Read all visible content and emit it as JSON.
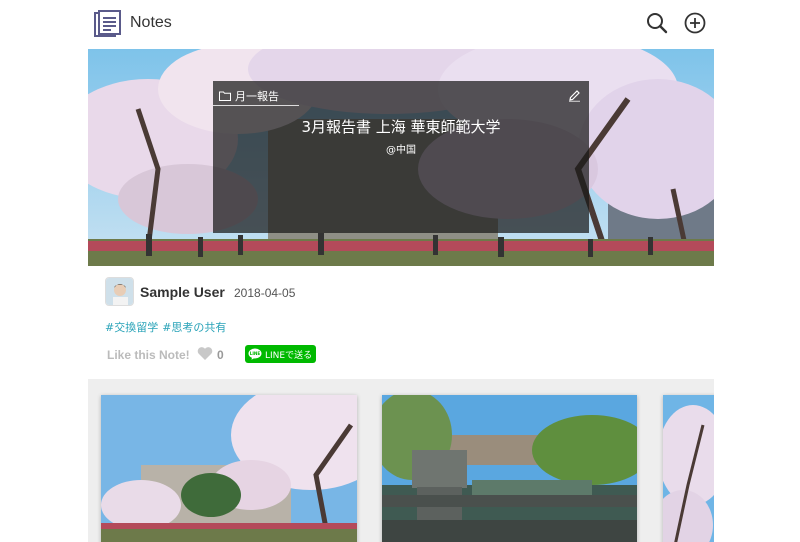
{
  "header": {
    "app_title": "Notes",
    "logo_icon": "notes-logo-icon",
    "search_icon": "search-icon",
    "add_icon": "add-circle-icon"
  },
  "hero": {
    "folder_label": "月一報告",
    "title": "3月報告書 上海 華東師範大学",
    "location": "@中国"
  },
  "author": {
    "name": "Sample User",
    "date": "2018-04-05"
  },
  "tags": [
    "#交換留学",
    "#思考の共有"
  ],
  "actions": {
    "like_label": "Like this Note!",
    "like_count": "0",
    "line_label": "LINEで送る"
  },
  "colors": {
    "tag": "#29a3b8",
    "line_green": "#00b900",
    "overlay": "#191919",
    "gallery_bg": "#eeeeee"
  }
}
